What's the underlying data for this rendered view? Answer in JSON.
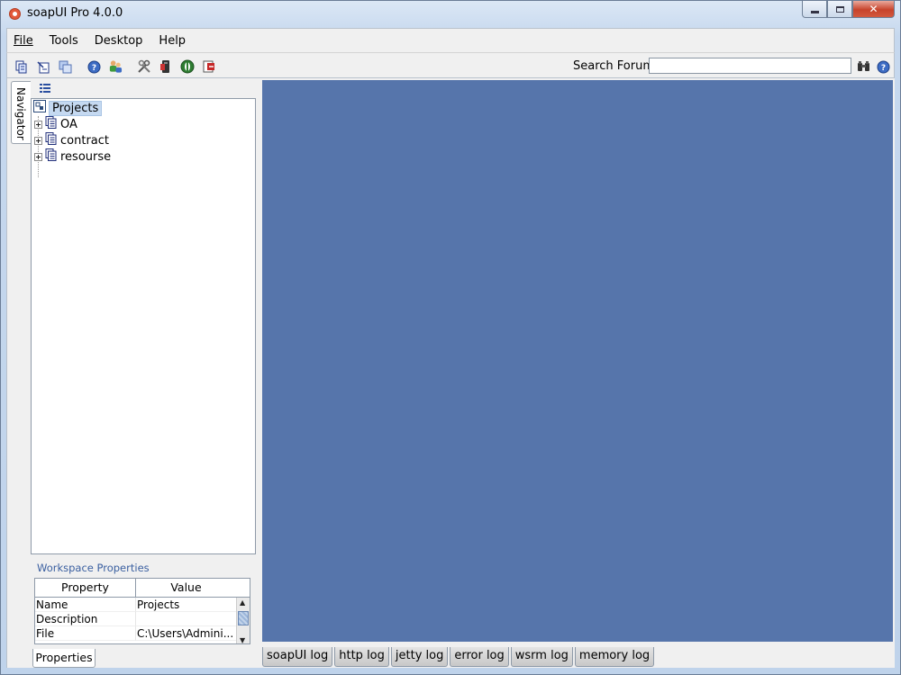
{
  "window": {
    "title": "soapUI Pro 4.0.0",
    "controls": {
      "minimize": "minimize",
      "maximize": "maximize",
      "close": "close"
    }
  },
  "menu": [
    {
      "label": "File"
    },
    {
      "label": "Tools"
    },
    {
      "label": "Desktop"
    },
    {
      "label": "Help"
    }
  ],
  "toolbar": {
    "icons": [
      "new-project-icon",
      "import-project-icon",
      "save-all-icon",
      "help-icon",
      "users-icon",
      "preferences-icon",
      "proxy-icon",
      "launch-icon",
      "exit-icon"
    ],
    "search_label": "Search Forum",
    "search_value": ""
  },
  "navigator": {
    "tab_label": "Navigator",
    "root": "Projects",
    "projects": [
      {
        "label": "OA"
      },
      {
        "label": "contract"
      },
      {
        "label": "resourse"
      }
    ]
  },
  "workspace_properties": {
    "title": "Workspace Properties",
    "columns": [
      "Property",
      "Value"
    ],
    "rows": [
      {
        "property": "Name",
        "value": "Projects"
      },
      {
        "property": "Description",
        "value": ""
      },
      {
        "property": "File",
        "value": "C:\\Users\\Admini..."
      }
    ],
    "tab_label": "Properties"
  },
  "log_tabs": [
    {
      "label": "soapUI log"
    },
    {
      "label": "http log"
    },
    {
      "label": "jetty log"
    },
    {
      "label": "error log"
    },
    {
      "label": "wsrm log"
    },
    {
      "label": "memory log"
    }
  ],
  "colors": {
    "desktop_background": "#5675ab",
    "selection": "#c5d9f1"
  }
}
